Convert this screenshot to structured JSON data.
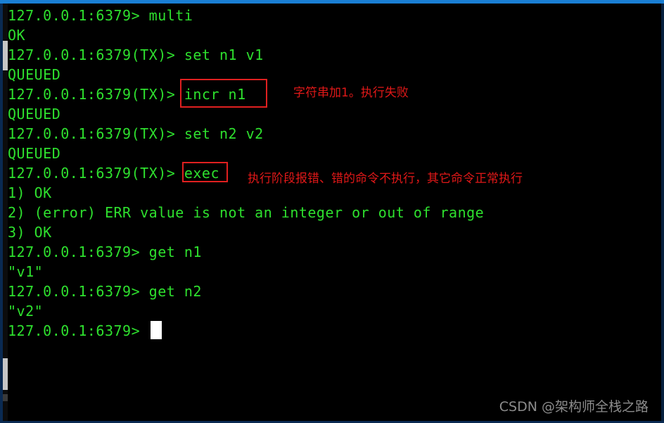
{
  "terminal": {
    "prompt_base": "127.0.0.1:6379",
    "prompt_tx": "127.0.0.1:6379(TX)",
    "cursor": "block-cursor",
    "lines": [
      {
        "text": "127.0.0.1:6379> multi"
      },
      {
        "text": "OK"
      },
      {
        "text": "127.0.0.1:6379(TX)> set n1 v1"
      },
      {
        "text": "QUEUED"
      },
      {
        "text": "127.0.0.1:6379(TX)> incr n1"
      },
      {
        "text": "QUEUED"
      },
      {
        "text": "127.0.0.1:6379(TX)> set n2 v2"
      },
      {
        "text": "QUEUED"
      },
      {
        "text": "127.0.0.1:6379(TX)> exec"
      },
      {
        "text": "1) OK"
      },
      {
        "text": "2) (error) ERR value is not an integer or out of range"
      },
      {
        "text": "3) OK"
      },
      {
        "text": "127.0.0.1:6379> get n1"
      },
      {
        "text": "\"v1\""
      },
      {
        "text": "127.0.0.1:6379> get n2"
      },
      {
        "text": "\"v2\""
      },
      {
        "text": "127.0.0.1:6379> "
      }
    ]
  },
  "annotations": {
    "highlight_incr_label": "incr n1",
    "highlight_exec_label": "exec",
    "note_incr": "字符串加1。执行失败",
    "note_exec": "执行阶段报错、错的命令不执行，其它命令正常执行"
  },
  "watermark": {
    "text": "CSDN @架构师全栈之路"
  },
  "colors": {
    "terminal_background": "#000000",
    "terminal_text": "#2ee02e",
    "annotation_red": "#e01818",
    "highlight_border": "#e02020",
    "title_bar_blue": "#1a7fd4",
    "cursor_white": "#ffffff",
    "watermark_gray": "#8c8c8c"
  }
}
